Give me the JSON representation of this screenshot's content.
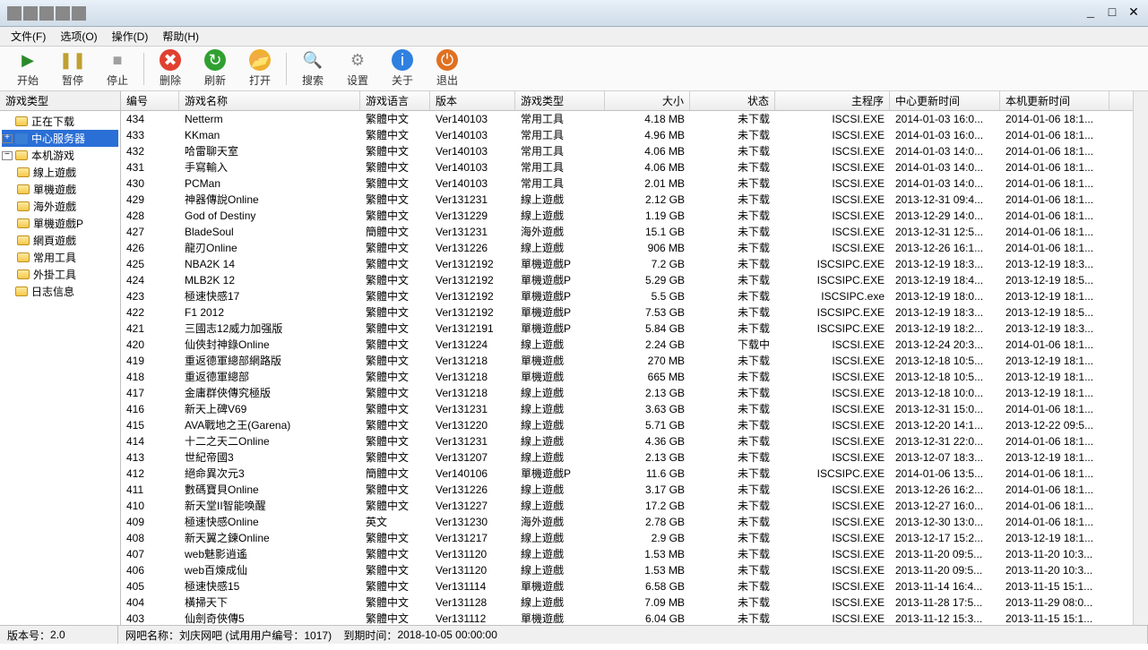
{
  "menu": {
    "file": "文件(F)",
    "options": "选项(O)",
    "operate": "操作(D)",
    "help": "帮助(H)"
  },
  "toolbar": {
    "start": "开始",
    "pause": "暂停",
    "stop": "停止",
    "delete": "删除",
    "refresh": "刷新",
    "open": "打开",
    "search": "搜索",
    "settings": "设置",
    "about": "关于",
    "exit": "退出"
  },
  "sidebar": {
    "header": "游戏类型",
    "nodes": [
      {
        "label": "正在下载",
        "type": "item",
        "indent": 0
      },
      {
        "label": "中心服务器",
        "type": "item",
        "indent": 0,
        "selected": true,
        "expandable": true,
        "expanded": false,
        "iconColor": "#3a7fd6"
      },
      {
        "label": "本机游戏",
        "type": "item",
        "indent": 0,
        "expandable": true,
        "expanded": true
      },
      {
        "label": "線上遊戲",
        "type": "item",
        "indent": 1
      },
      {
        "label": "單機遊戲",
        "type": "item",
        "indent": 1
      },
      {
        "label": "海外遊戲",
        "type": "item",
        "indent": 1
      },
      {
        "label": "單機遊戲P",
        "type": "item",
        "indent": 1
      },
      {
        "label": "網頁遊戲",
        "type": "item",
        "indent": 1
      },
      {
        "label": "常用工具",
        "type": "item",
        "indent": 1
      },
      {
        "label": "外掛工具",
        "type": "item",
        "indent": 1
      },
      {
        "label": "日志信息",
        "type": "item",
        "indent": 0
      }
    ]
  },
  "grid": {
    "columns": [
      "编号",
      "游戏名称",
      "游戏语言",
      "版本",
      "游戏类型",
      "大小",
      "状态",
      "主程序",
      "中心更新时间",
      "本机更新时间"
    ],
    "rows": [
      [
        "434",
        "Netterm",
        "繁體中文",
        "Ver140103",
        "常用工具",
        "4.18 MB",
        "未下载",
        "ISCSI.EXE",
        "2014-01-03 16:0...",
        "2014-01-06 18:1..."
      ],
      [
        "433",
        "KKman",
        "繁體中文",
        "Ver140103",
        "常用工具",
        "4.96 MB",
        "未下载",
        "ISCSI.EXE",
        "2014-01-03 16:0...",
        "2014-01-06 18:1..."
      ],
      [
        "432",
        "哈雷聊天室",
        "繁體中文",
        "Ver140103",
        "常用工具",
        "4.06 MB",
        "未下载",
        "ISCSI.EXE",
        "2014-01-03 14:0...",
        "2014-01-06 18:1..."
      ],
      [
        "431",
        "手寫輸入",
        "繁體中文",
        "Ver140103",
        "常用工具",
        "4.06 MB",
        "未下载",
        "ISCSI.EXE",
        "2014-01-03 14:0...",
        "2014-01-06 18:1..."
      ],
      [
        "430",
        "PCMan",
        "繁體中文",
        "Ver140103",
        "常用工具",
        "2.01 MB",
        "未下载",
        "ISCSI.EXE",
        "2014-01-03 14:0...",
        "2014-01-06 18:1..."
      ],
      [
        "429",
        "神器傳說Online",
        "繁體中文",
        "Ver131231",
        "線上遊戲",
        "2.12 GB",
        "未下载",
        "ISCSI.EXE",
        "2013-12-31 09:4...",
        "2014-01-06 18:1..."
      ],
      [
        "428",
        "God of Destiny",
        "繁體中文",
        "Ver131229",
        "線上遊戲",
        "1.19 GB",
        "未下载",
        "ISCSI.EXE",
        "2013-12-29 14:0...",
        "2014-01-06 18:1..."
      ],
      [
        "427",
        "BladeSoul",
        "簡體中文",
        "Ver131231",
        "海外遊戲",
        "15.1 GB",
        "未下载",
        "ISCSI.EXE",
        "2013-12-31 12:5...",
        "2014-01-06 18:1..."
      ],
      [
        "426",
        "龍刃Online",
        "繁體中文",
        "Ver131226",
        "線上遊戲",
        "906 MB",
        "未下载",
        "ISCSI.EXE",
        "2013-12-26 16:1...",
        "2014-01-06 18:1..."
      ],
      [
        "425",
        "NBA2K 14",
        "繁體中文",
        "Ver1312192",
        "單機遊戲P",
        "7.2 GB",
        "未下载",
        "ISCSIPC.EXE",
        "2013-12-19 18:3...",
        "2013-12-19 18:3..."
      ],
      [
        "424",
        "MLB2K 12",
        "繁體中文",
        "Ver1312192",
        "單機遊戲P",
        "5.29 GB",
        "未下载",
        "ISCSIPC.EXE",
        "2013-12-19 18:4...",
        "2013-12-19 18:5..."
      ],
      [
        "423",
        "極速快感17",
        "繁體中文",
        "Ver1312192",
        "單機遊戲P",
        "5.5 GB",
        "未下载",
        "ISCSIPC.exe",
        "2013-12-19 18:0...",
        "2013-12-19 18:1..."
      ],
      [
        "422",
        "F1 2012",
        "繁體中文",
        "Ver1312192",
        "單機遊戲P",
        "7.53 GB",
        "未下载",
        "ISCSIPC.EXE",
        "2013-12-19 18:3...",
        "2013-12-19 18:5..."
      ],
      [
        "421",
        "三國志12威力加强版",
        "繁體中文",
        "Ver1312191",
        "單機遊戲P",
        "5.84 GB",
        "未下载",
        "ISCSIPC.EXE",
        "2013-12-19 18:2...",
        "2013-12-19 18:3..."
      ],
      [
        "420",
        "仙俠封神錄Online",
        "繁體中文",
        "Ver131224",
        "線上遊戲",
        "2.24 GB",
        "下载中",
        "ISCSI.EXE",
        "2013-12-24 20:3...",
        "2014-01-06 18:1..."
      ],
      [
        "419",
        "重返德軍總部網路版",
        "繁體中文",
        "Ver131218",
        "單機遊戲",
        "270 MB",
        "未下载",
        "ISCSI.EXE",
        "2013-12-18 10:5...",
        "2013-12-19 18:1..."
      ],
      [
        "418",
        "重返德軍總部",
        "繁體中文",
        "Ver131218",
        "單機遊戲",
        "665 MB",
        "未下载",
        "ISCSI.EXE",
        "2013-12-18 10:5...",
        "2013-12-19 18:1..."
      ],
      [
        "417",
        "金庸群俠傳究極版",
        "繁體中文",
        "Ver131218",
        "線上遊戲",
        "2.13 GB",
        "未下载",
        "ISCSI.EXE",
        "2013-12-18 10:0...",
        "2013-12-19 18:1..."
      ],
      [
        "416",
        "新天上碑V69",
        "繁體中文",
        "Ver131231",
        "線上遊戲",
        "3.63 GB",
        "未下载",
        "ISCSI.EXE",
        "2013-12-31 15:0...",
        "2014-01-06 18:1..."
      ],
      [
        "415",
        "AVA戰地之王(Garena)",
        "繁體中文",
        "Ver131220",
        "線上遊戲",
        "5.71 GB",
        "未下载",
        "ISCSI.EXE",
        "2013-12-20 14:1...",
        "2013-12-22 09:5..."
      ],
      [
        "414",
        "十二之天二Online",
        "繁體中文",
        "Ver131231",
        "線上遊戲",
        "4.36 GB",
        "未下载",
        "ISCSI.EXE",
        "2013-12-31 22:0...",
        "2014-01-06 18:1..."
      ],
      [
        "413",
        "世紀帝國3",
        "繁體中文",
        "Ver131207",
        "線上遊戲",
        "2.13 GB",
        "未下载",
        "ISCSI.EXE",
        "2013-12-07 18:3...",
        "2013-12-19 18:1..."
      ],
      [
        "412",
        "絕命異次元3",
        "簡體中文",
        "Ver140106",
        "單機遊戲P",
        "11.6 GB",
        "未下载",
        "ISCSIPC.EXE",
        "2014-01-06 13:5...",
        "2014-01-06 18:1..."
      ],
      [
        "411",
        "數碼寶貝Online",
        "繁體中文",
        "Ver131226",
        "線上遊戲",
        "3.17 GB",
        "未下载",
        "ISCSI.EXE",
        "2013-12-26 16:2...",
        "2014-01-06 18:1..."
      ],
      [
        "410",
        "新天堂II智能唤醒",
        "繁體中文",
        "Ver131227",
        "線上遊戲",
        "17.2 GB",
        "未下载",
        "ISCSI.EXE",
        "2013-12-27 16:0...",
        "2014-01-06 18:1..."
      ],
      [
        "409",
        "極速快感Online",
        "英文",
        "Ver131230",
        "海外遊戲",
        "2.78 GB",
        "未下载",
        "ISCSI.EXE",
        "2013-12-30 13:0...",
        "2014-01-06 18:1..."
      ],
      [
        "408",
        "新天翼之鍊Online",
        "繁體中文",
        "Ver131217",
        "線上遊戲",
        "2.9 GB",
        "未下载",
        "ISCSI.EXE",
        "2013-12-17 15:2...",
        "2013-12-19 18:1..."
      ],
      [
        "407",
        "web魅影逍遙",
        "繁體中文",
        "Ver131120",
        "線上遊戲",
        "1.53 MB",
        "未下载",
        "ISCSI.EXE",
        "2013-11-20 09:5...",
        "2013-11-20 10:3..."
      ],
      [
        "406",
        "web百煉成仙",
        "繁體中文",
        "Ver131120",
        "線上遊戲",
        "1.53 MB",
        "未下载",
        "ISCSI.EXE",
        "2013-11-20 09:5...",
        "2013-11-20 10:3..."
      ],
      [
        "405",
        "極速快感15",
        "繁體中文",
        "Ver131114",
        "單機遊戲",
        "6.58 GB",
        "未下载",
        "ISCSI.EXE",
        "2013-11-14 16:4...",
        "2013-11-15 15:1..."
      ],
      [
        "404",
        "橫掃天下",
        "繁體中文",
        "Ver131128",
        "線上遊戲",
        "7.09 MB",
        "未下载",
        "ISCSI.EXE",
        "2013-11-28 17:5...",
        "2013-11-29 08:0..."
      ],
      [
        "403",
        "仙劍奇俠傳5",
        "繁體中文",
        "Ver131112",
        "單機遊戲",
        "6.04 GB",
        "未下载",
        "ISCSI.EXE",
        "2013-11-12 15:3...",
        "2013-11-15 15:1..."
      ]
    ]
  },
  "status": {
    "version_label": "版本号：",
    "version": "2.0",
    "bar_label": "网吧名称：",
    "bar_name": "刘庆网吧",
    "trial": "(试用用户编号：1017)",
    "expire_label": "到期时间：",
    "expire": "2018-10-05 00:00:00"
  }
}
